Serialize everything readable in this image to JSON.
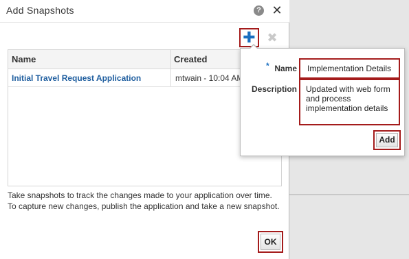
{
  "dialog": {
    "title": "Add Snapshots",
    "help_glyph": "?",
    "close_glyph": "✕",
    "toolbar": {
      "add_glyph": "✚",
      "delete_glyph": "✖"
    },
    "table": {
      "columns": [
        "Name",
        "Created"
      ],
      "rows": [
        {
          "name": "Initial Travel Request Application",
          "created": "mtwain - 10:04 AM"
        }
      ]
    },
    "footer_text": "Take snapshots to track the changes made to your application over time. To capture new changes, publish the application and take a new snapshot.",
    "ok_label": "OK"
  },
  "popup": {
    "required_marker": "*",
    "name_label": "Name",
    "name_value": "Implementation Details",
    "description_label": "Description",
    "description_value": "Updated with web form and process implementation details",
    "add_label": "Add"
  },
  "colors": {
    "highlight_border": "#a41b1b",
    "link": "#1f5e9f",
    "accent": "#1a6fc0"
  }
}
